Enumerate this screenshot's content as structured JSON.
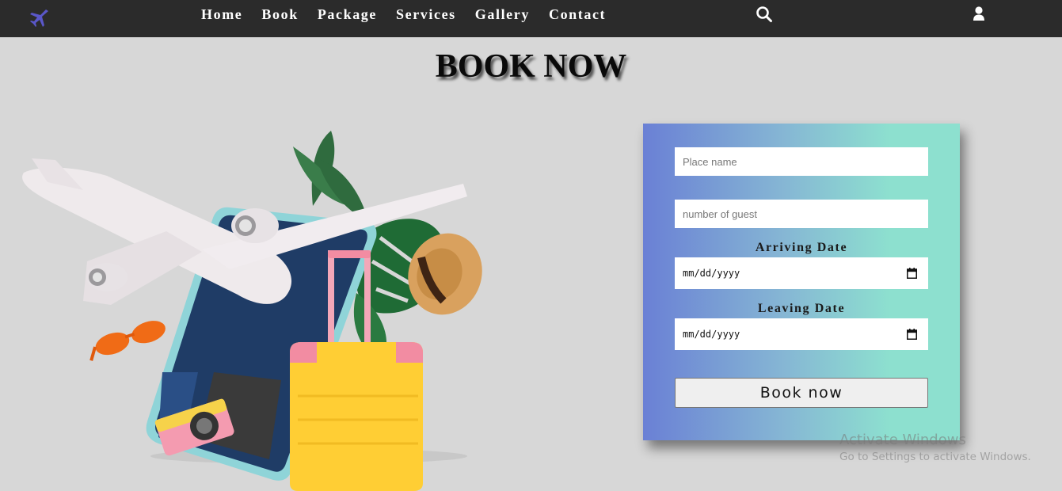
{
  "nav": {
    "links": [
      "Home",
      "Book",
      "Package",
      "Services",
      "Gallery",
      "Contact"
    ]
  },
  "page": {
    "title": "BOOK NOW"
  },
  "form": {
    "place_placeholder": "Place name",
    "guest_placeholder": "number of guest",
    "arriving_label": "Arriving Date",
    "arriving_value": "mm/dd/yyyy",
    "leaving_label": "Leaving Date",
    "leaving_value": "mm/dd/yyyy",
    "submit_label": "Book now"
  },
  "watermark": {
    "title": "Activate Windows",
    "subtitle": "Go to Settings to activate Windows."
  },
  "colors": {
    "navbar": "#2b2b2b",
    "logo": "#5a57c9",
    "gradient_start": "#6a80d5",
    "gradient_end": "#8de0cf"
  }
}
